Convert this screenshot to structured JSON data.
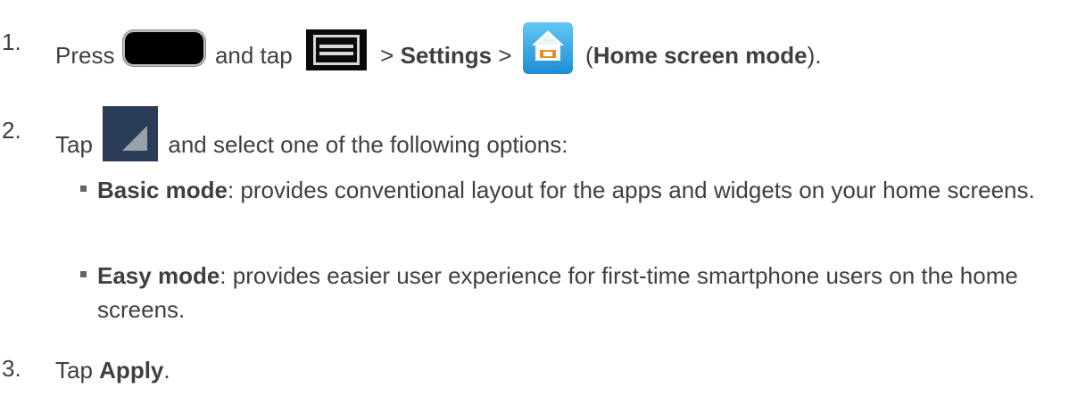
{
  "steps": [
    {
      "number": "1.",
      "parts": {
        "press": "Press",
        "and_tap": "and tap",
        "sep1": ">",
        "settings": "Settings",
        "sep2": ">",
        "open_paren": "(",
        "home_screen_mode": "Home screen mode",
        "close_paren": ")."
      }
    },
    {
      "number": "2.",
      "parts": {
        "tap": "Tap",
        "rest": "and select one of the following options:"
      }
    },
    {
      "number": "3.",
      "parts": {
        "tap": "Tap",
        "apply": "Apply",
        "period": "."
      }
    }
  ],
  "options": [
    {
      "term": "Basic mode",
      "description": ": provides conventional layout for the apps and widgets on your home screens."
    },
    {
      "term": "Easy mode",
      "description": ": provides easier user experience for first-time smartphone users on the home screens."
    }
  ],
  "icons": {
    "home_key": "home-key-icon",
    "menu_key": "menu-key-icon",
    "home_screen_mode": "home-screen-mode-icon",
    "panel": "home-screen-panel-icon"
  },
  "colors": {
    "text": "#3f3f3f",
    "icon_blue": "#2aa3e3",
    "panel_bg": "#2b3c58"
  }
}
